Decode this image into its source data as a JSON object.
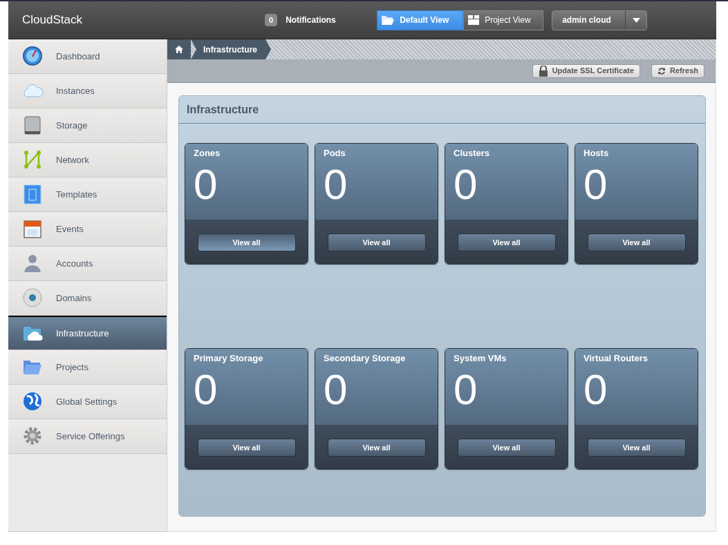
{
  "header": {
    "logo": "CloudStack",
    "notifications": {
      "count": "0",
      "label": "Notifications"
    },
    "views": [
      {
        "label": "Default View",
        "selected": true
      },
      {
        "label": "Project View",
        "selected": false
      }
    ],
    "user": "admin cloud"
  },
  "sidebar": {
    "items": [
      {
        "label": "Dashboard",
        "selected": false
      },
      {
        "label": "Instances",
        "selected": false
      },
      {
        "label": "Storage",
        "selected": false
      },
      {
        "label": "Network",
        "selected": false
      },
      {
        "label": "Templates",
        "selected": false
      },
      {
        "label": "Events",
        "selected": false
      },
      {
        "label": "Accounts",
        "selected": false
      },
      {
        "label": "Domains",
        "selected": false
      },
      {
        "label": "Infrastructure",
        "selected": true
      },
      {
        "label": "Projects",
        "selected": false
      },
      {
        "label": "Global Settings",
        "selected": false
      },
      {
        "label": "Service Offerings",
        "selected": false
      }
    ]
  },
  "breadcrumb": [
    "Infrastructure"
  ],
  "toolbar": {
    "buttons": [
      "Update SSL Certificate",
      "Refresh"
    ]
  },
  "panel": {
    "title": "Infrastructure",
    "cards": [
      {
        "title": "Zones",
        "count": "0",
        "button": "View all",
        "highlighted": true
      },
      {
        "title": "Pods",
        "count": "0",
        "button": "View all",
        "highlighted": false
      },
      {
        "title": "Clusters",
        "count": "0",
        "button": "View all",
        "highlighted": false
      },
      {
        "title": "Hosts",
        "count": "0",
        "button": "View all",
        "highlighted": false
      },
      {
        "title": "Primary Storage",
        "count": "0",
        "button": "View all",
        "highlighted": false
      },
      {
        "title": "Secondary Storage",
        "count": "0",
        "button": "View all",
        "highlighted": false
      },
      {
        "title": "System VMs",
        "count": "0",
        "button": "View all",
        "highlighted": false
      },
      {
        "title": "Virtual Routers",
        "count": "0",
        "button": "View all",
        "highlighted": false
      }
    ]
  }
}
